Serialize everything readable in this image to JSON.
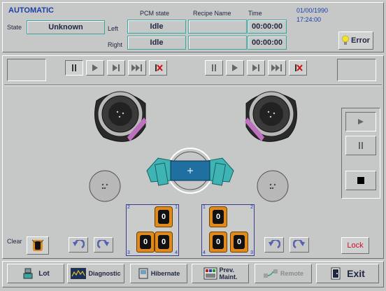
{
  "header": {
    "mode": "AUTOMATIC",
    "state_label": "State",
    "state_value": "Unknown",
    "col_pcm": "PCM state",
    "col_recipe": "Recipe Name",
    "col_time": "Time",
    "date": "01/00/1990",
    "clock": "17:24:00",
    "left_label": "Left",
    "right_label": "Right",
    "left_pcm": "Idle",
    "right_pcm": "Idle",
    "left_recipe": "",
    "right_recipe": "",
    "left_time": "00:00:00",
    "right_time": "00:00:00",
    "error_label": "Error"
  },
  "tools": {
    "clear_label": "Clear",
    "lock_label": "Lock",
    "cassette_left_slots": [
      "0",
      "0",
      "0"
    ],
    "cassette_right_slots": [
      "0",
      "0",
      "0"
    ],
    "corner_left": [
      "2",
      "1",
      "3",
      "4"
    ],
    "corner_right": [
      "1",
      "2",
      "4",
      "3"
    ]
  },
  "footer": {
    "lot": "Lot",
    "diagnostic": "Diagnostic",
    "hibernate": "Hibernate",
    "prev_maint_1": "Prev.",
    "prev_maint_2": "Maint.",
    "remote": "Remote",
    "exit": "Exit"
  },
  "colors": {
    "teal": "#3aa6a0",
    "lock_red": "#c8102e",
    "error_bulb": "#f5e12a",
    "robot_teal": "#3fb4b4",
    "magenta": "#c070c0",
    "cassette_orange": "#e08a1e"
  }
}
